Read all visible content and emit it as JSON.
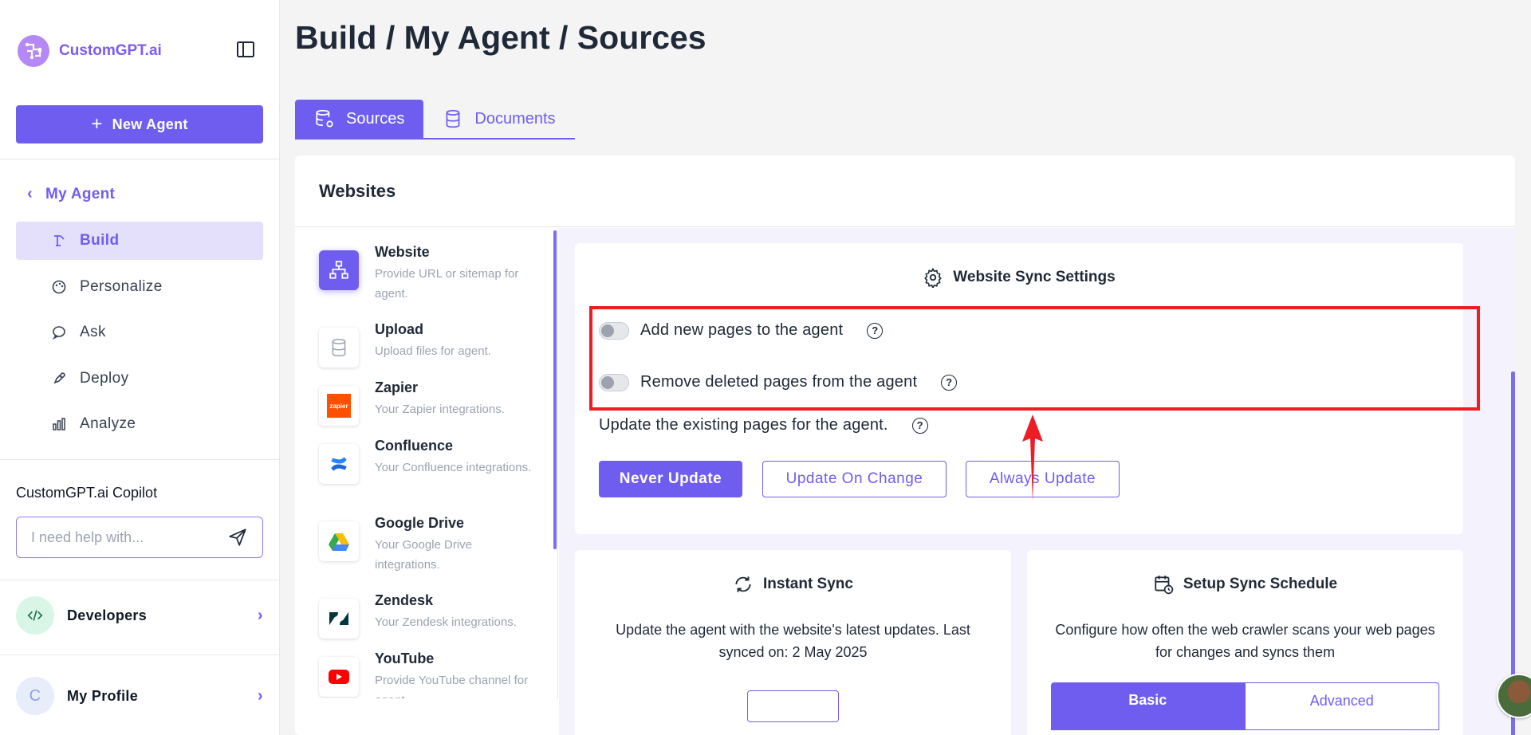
{
  "sidebar": {
    "brand": "CustomGPT.ai",
    "new_agent_label": "New Agent",
    "back_label": "My Agent",
    "nav": [
      {
        "label": "Build",
        "icon": "build-icon",
        "active": true
      },
      {
        "label": "Personalize",
        "icon": "palette-icon"
      },
      {
        "label": "Ask",
        "icon": "chat-icon"
      },
      {
        "label": "Deploy",
        "icon": "rocket-icon"
      },
      {
        "label": "Analyze",
        "icon": "chart-icon"
      }
    ],
    "copilot_title": "CustomGPT.ai Copilot",
    "copilot_placeholder": "I need help with...",
    "developers_label": "Developers",
    "profile_initial": "C",
    "profile_label": "My Profile"
  },
  "header": {
    "title": "Build / My Agent / Sources",
    "tabs": [
      {
        "label": "Sources",
        "active": true
      },
      {
        "label": "Documents"
      }
    ]
  },
  "panel": {
    "title": "Websites",
    "sources": [
      {
        "title": "Website",
        "desc": "Provide URL or sitemap for agent."
      },
      {
        "title": "Upload",
        "desc": "Upload files for agent."
      },
      {
        "title": "Zapier",
        "desc": "Your Zapier integrations.",
        "logo_text": "zapier"
      },
      {
        "title": "Confluence",
        "desc": "Your Confluence integrations."
      },
      {
        "title": "Google Drive",
        "desc": "Your Google Drive integrations."
      },
      {
        "title": "Zendesk",
        "desc": "Your Zendesk integrations."
      },
      {
        "title": "YouTube",
        "desc": "Provide YouTube channel for agent."
      }
    ]
  },
  "sync_settings": {
    "title": "Website Sync Settings",
    "toggles": [
      {
        "label": "Add new pages to the agent",
        "on": false
      },
      {
        "label": "Remove deleted pages from the agent",
        "on": false
      }
    ],
    "update_label": "Update the existing pages for the agent.",
    "buttons": {
      "never": "Never Update",
      "on_change": "Update On Change",
      "always": "Always Update"
    }
  },
  "instant_sync": {
    "title": "Instant Sync",
    "text": "Update the agent with the website's latest updates. Last synced on: 2 May 2025"
  },
  "schedule": {
    "title": "Setup Sync Schedule",
    "text": "Configure how often the web crawler scans your web pages for changes and syncs them",
    "tabs": [
      "Basic",
      "Advanced"
    ]
  },
  "colors": {
    "accent": "#6f5df0",
    "highlight": "#ee1c25"
  }
}
